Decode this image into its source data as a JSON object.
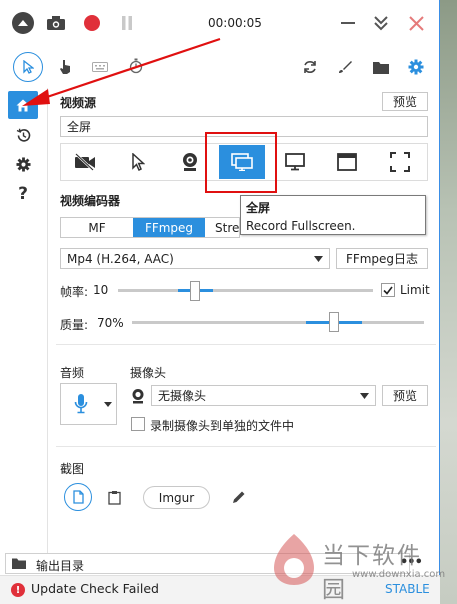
{
  "window": {
    "timer": "00:00:05"
  },
  "sidebar": {
    "help_label": "?"
  },
  "video_source": {
    "title": "视频源",
    "preview_label": "预览",
    "selected_value": "全屏"
  },
  "tooltip": {
    "title": "全屏",
    "description": "Record Fullscreen."
  },
  "encoder": {
    "title": "视频编码器",
    "tabs": [
      "MF",
      "FFmpeg",
      "Stre"
    ],
    "format_value": "Mp4 (H.264, AAC)",
    "log_button": "FFmpeg日志"
  },
  "framerate": {
    "label": "帧率:",
    "value": "10",
    "limit_label": "Limit",
    "limit_checked": true
  },
  "quality": {
    "label": "质量:",
    "value": "70%"
  },
  "audio": {
    "title": "音频"
  },
  "camera": {
    "title": "摄像头",
    "selected": "无摄像头",
    "preview_label": "预览",
    "separate_file_label": "录制摄像头到单独的文件中"
  },
  "screenshot": {
    "title": "截图",
    "imgur_label": "Imgur"
  },
  "footer": {
    "output_folder_label": "输出目录",
    "status_text": "Update Check Failed",
    "stable_label": "STABLE",
    "more_label": "•••"
  },
  "watermark": {
    "brand": "当下软件园",
    "url": "www.downxia.com"
  },
  "colors": {
    "accent": "#2b8fde",
    "record_red": "#e0303a",
    "annotation_red": "#e01010"
  }
}
